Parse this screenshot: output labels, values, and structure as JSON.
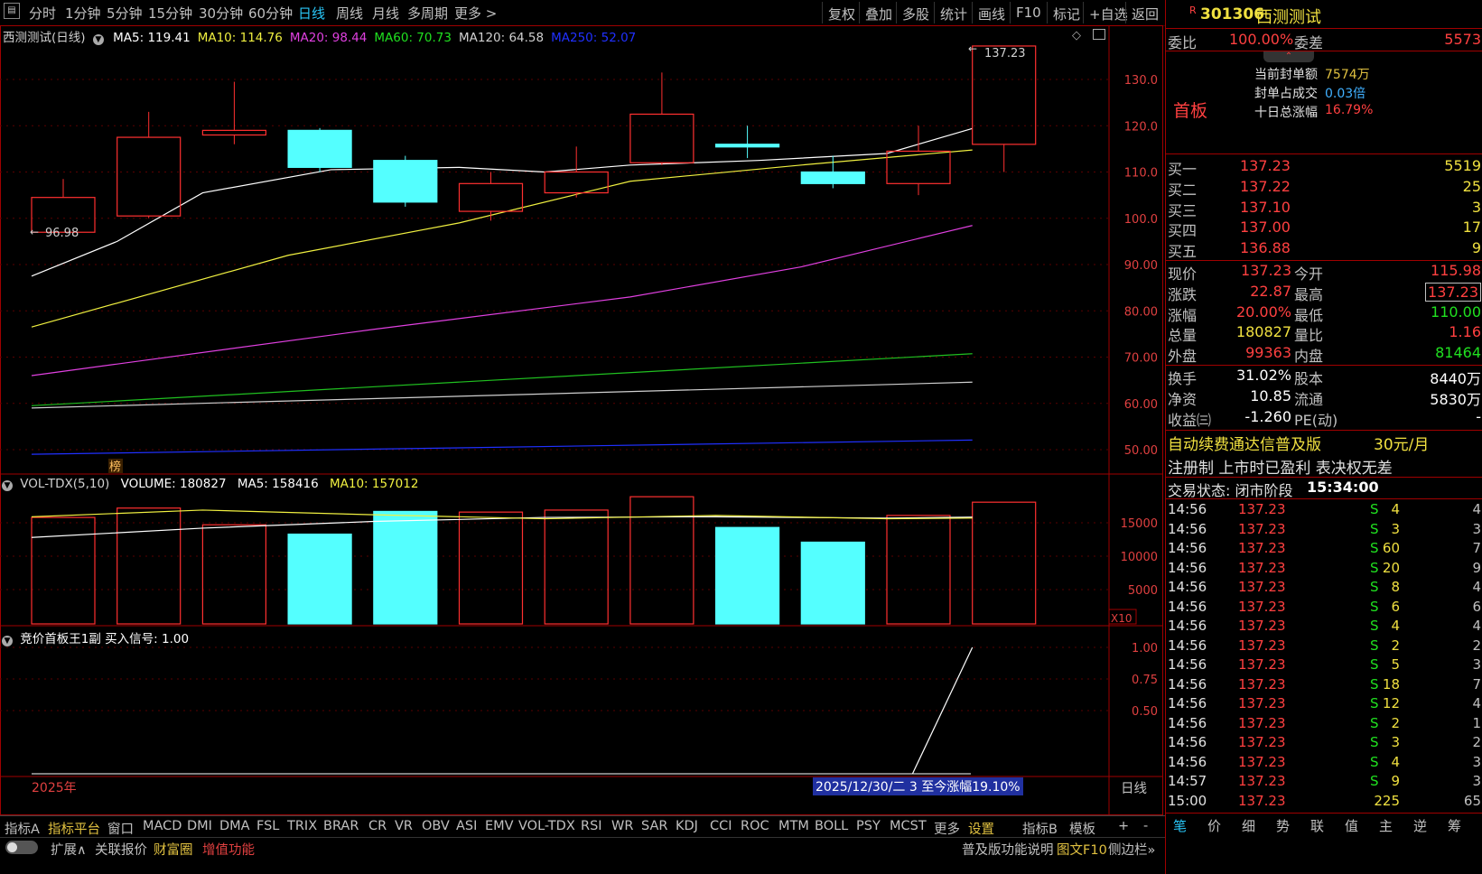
{
  "toolbar": {
    "left_items": [
      "分时",
      "1分钟",
      "5分钟",
      "15分钟",
      "30分钟",
      "60分钟",
      "日线",
      "周线",
      "月线",
      "多周期",
      "更多 >"
    ],
    "active": "日线",
    "right_items": [
      "复权",
      "叠加",
      "多股",
      "统计",
      "画线",
      "F10",
      "标记",
      "+自选",
      "返回"
    ]
  },
  "main": {
    "title": "西测测试(日线)",
    "ma": [
      {
        "label": "MA5: 119.41",
        "color": "#ffffff"
      },
      {
        "label": "MA10: 114.76",
        "color": "#f0f040"
      },
      {
        "label": "MA20: 98.44",
        "color": "#e040e0"
      },
      {
        "label": "MA60: 70.73",
        "color": "#20e020"
      },
      {
        "label": "MA120: 64.58",
        "color": "#d0d0d0"
      },
      {
        "label": "MA250: 52.07",
        "color": "#2030ff"
      }
    ],
    "high_label": "137.23",
    "low_label": "96.98",
    "bang_label": "榜",
    "y_ticks": [
      "130.0",
      "120.0",
      "110.0",
      "100.0",
      "90.00",
      "80.00",
      "70.00",
      "60.00",
      "50.00"
    ]
  },
  "volume": {
    "legend": [
      "VOL-TDX(5,10)",
      "VOLUME: 180827",
      "MA5: 158416",
      "MA10: 157012"
    ],
    "y_ticks": [
      "15000",
      "10000",
      "5000"
    ],
    "unit": "X10"
  },
  "indicator": {
    "legend": "竞价首板王1副  买入信号: 1.00",
    "y_ticks": [
      "1.00",
      "0.75",
      "0.50"
    ]
  },
  "xaxis": {
    "year": "2025年",
    "info": "2025/12/30/二 3 至今涨幅19.10%",
    "period": "日线"
  },
  "tabs": [
    "指标A",
    "指标平台",
    "窗口",
    "MACD",
    "DMI",
    "DMA",
    "FSL",
    "TRIX",
    "BRAR",
    "CR",
    "VR",
    "OBV",
    "ASI",
    "EMV",
    "VOL-TDX",
    "RSI",
    "WR",
    "SAR",
    "KDJ",
    "CCI",
    "ROC",
    "MTM",
    "BOLL",
    "PSY",
    "MCST",
    "更多",
    "设置",
    "指标B",
    "模板",
    "+",
    "-"
  ],
  "status": {
    "expand": "扩展∧",
    "linked": "关联报价",
    "cfq": "财富圈",
    "zzgn": "增值功能",
    "help": "普及版功能说明",
    "f10": "图文F10",
    "side": "侧边栏»"
  },
  "quote": {
    "code": "301306",
    "name": "西测测试",
    "flag": "R",
    "weibi_label": "委比",
    "weibi": "100.00%",
    "weicha_label": "委差",
    "weicha": "5573",
    "board": "首板",
    "seal_lines": [
      {
        "label": "当前封单额",
        "value": "7574万"
      },
      {
        "label": "封单占成交",
        "value": "0.03倍"
      },
      {
        "label": "十日总涨幅",
        "value": "16.79%"
      }
    ],
    "bids": [
      {
        "label": "买一",
        "price": "137.23",
        "vol": "5519"
      },
      {
        "label": "买二",
        "price": "137.22",
        "vol": "25"
      },
      {
        "label": "买三",
        "price": "137.10",
        "vol": "3"
      },
      {
        "label": "买四",
        "price": "137.00",
        "vol": "17"
      },
      {
        "label": "买五",
        "price": "136.88",
        "vol": "9"
      }
    ],
    "stats": [
      {
        "l1": "现价",
        "v1": "137.23",
        "c1": "red",
        "l2": "今开",
        "v2": "115.98",
        "c2": "red"
      },
      {
        "l1": "涨跌",
        "v1": "22.87",
        "c1": "red",
        "l2": "最高",
        "v2": "137.23",
        "c2": "red"
      },
      {
        "l1": "涨幅",
        "v1": "20.00%",
        "c1": "red",
        "l2": "最低",
        "v2": "110.00",
        "c2": "green"
      },
      {
        "l1": "总量",
        "v1": "180827",
        "c1": "yellow",
        "l2": "量比",
        "v2": "1.16",
        "c2": "red"
      },
      {
        "l1": "外盘",
        "v1": "99363",
        "c1": "red",
        "l2": "内盘",
        "v2": "81464",
        "c2": "green"
      }
    ],
    "stats2": [
      {
        "l1": "换手",
        "v1": "31.02%",
        "l2": "股本",
        "v2": "8440万"
      },
      {
        "l1": "净资",
        "v1": "10.85",
        "l2": "流通",
        "v2": "5830万"
      },
      {
        "l1": "收益㈢",
        "v1": "-1.260",
        "l2": "PE(动)",
        "v2": "-"
      }
    ],
    "ad1": "自动续费通达信普及版",
    "ad1_price": "30元/月",
    "ad2": "注册制 上市时已盈利 表决权无差",
    "trade_state": "交易状态: 闭市阶段",
    "trade_time": "15:34:00",
    "ticks": [
      {
        "t": "14:56",
        "p": "137.23",
        "q": "4",
        "s": "S",
        "n": "4"
      },
      {
        "t": "14:56",
        "p": "137.23",
        "q": "3",
        "s": "S",
        "n": "3"
      },
      {
        "t": "14:56",
        "p": "137.23",
        "q": "60",
        "s": "S",
        "n": "7"
      },
      {
        "t": "14:56",
        "p": "137.23",
        "q": "20",
        "s": "S",
        "n": "9"
      },
      {
        "t": "14:56",
        "p": "137.23",
        "q": "8",
        "s": "S",
        "n": "4"
      },
      {
        "t": "14:56",
        "p": "137.23",
        "q": "6",
        "s": "S",
        "n": "6"
      },
      {
        "t": "14:56",
        "p": "137.23",
        "q": "4",
        "s": "S",
        "n": "4"
      },
      {
        "t": "14:56",
        "p": "137.23",
        "q": "2",
        "s": "S",
        "n": "2"
      },
      {
        "t": "14:56",
        "p": "137.23",
        "q": "5",
        "s": "S",
        "n": "3"
      },
      {
        "t": "14:56",
        "p": "137.23",
        "q": "18",
        "s": "S",
        "n": "7"
      },
      {
        "t": "14:56",
        "p": "137.23",
        "q": "12",
        "s": "S",
        "n": "4"
      },
      {
        "t": "14:56",
        "p": "137.23",
        "q": "2",
        "s": "S",
        "n": "1"
      },
      {
        "t": "14:56",
        "p": "137.23",
        "q": "3",
        "s": "S",
        "n": "2"
      },
      {
        "t": "14:56",
        "p": "137.23",
        "q": "4",
        "s": "S",
        "n": "3"
      },
      {
        "t": "14:57",
        "p": "137.23",
        "q": "9",
        "s": "S",
        "n": "3"
      },
      {
        "t": "15:00",
        "p": "137.23",
        "q": "225",
        "s": "",
        "n": "65"
      }
    ],
    "bottom_tabs": [
      "笔",
      "价",
      "细",
      "势",
      "联",
      "值",
      "主",
      "逆",
      "筹"
    ]
  },
  "chart_data": {
    "type": "candlestick",
    "candles": [
      {
        "o": 96.98,
        "c": 104.5,
        "h": 108.5,
        "l": 96.98,
        "up": true
      },
      {
        "o": 100.5,
        "c": 117.5,
        "h": 123.0,
        "l": 100.0,
        "up": true
      },
      {
        "o": 118.0,
        "c": 119.0,
        "h": 129.5,
        "l": 116.0,
        "up": true
      },
      {
        "o": 119.0,
        "c": 111.0,
        "h": 119.5,
        "l": 110.0,
        "up": false
      },
      {
        "o": 112.5,
        "c": 103.5,
        "h": 113.5,
        "l": 102.5,
        "up": false
      },
      {
        "o": 101.5,
        "c": 107.5,
        "h": 110.0,
        "l": 99.5,
        "up": true
      },
      {
        "o": 105.5,
        "c": 110.0,
        "h": 115.5,
        "l": 104.5,
        "up": true
      },
      {
        "o": 112.0,
        "c": 122.5,
        "h": 131.5,
        "l": 111.5,
        "up": true
      },
      {
        "o": 116.0,
        "c": 115.5,
        "h": 120.0,
        "l": 113.0,
        "up": false
      },
      {
        "o": 110.0,
        "c": 107.5,
        "h": 113.5,
        "l": 106.5,
        "up": false
      },
      {
        "o": 107.5,
        "c": 114.5,
        "h": 120.0,
        "l": 105.0,
        "up": true
      },
      {
        "o": 115.98,
        "c": 137.23,
        "h": 137.23,
        "l": 110.0,
        "up": true
      }
    ],
    "ma5": [
      [
        0,
        87.5
      ],
      [
        2,
        95
      ],
      [
        4,
        105.5
      ],
      [
        7,
        110.5
      ],
      [
        10,
        111
      ],
      [
        12,
        110
      ],
      [
        14,
        111.5
      ],
      [
        17,
        112.5
      ],
      [
        20,
        114
      ],
      [
        22,
        119.41
      ]
    ],
    "ma10": [
      [
        0,
        76.5
      ],
      [
        6,
        92
      ],
      [
        10,
        99
      ],
      [
        14,
        108
      ],
      [
        18,
        111.5
      ],
      [
        22,
        114.76
      ]
    ],
    "ma20": [
      [
        0,
        66
      ],
      [
        8,
        76
      ],
      [
        14,
        83
      ],
      [
        18,
        89.5
      ],
      [
        22,
        98.44
      ]
    ],
    "ma60": [
      [
        0,
        59.5
      ],
      [
        22,
        70.73
      ]
    ],
    "ma120": [
      [
        0,
        59
      ],
      [
        22,
        64.58
      ]
    ],
    "ma250": [
      [
        0,
        49
      ],
      [
        22,
        52.07
      ]
    ],
    "volumes": [
      {
        "v": 15800,
        "up": true
      },
      {
        "v": 17200,
        "up": true
      },
      {
        "v": 14700,
        "up": true
      },
      {
        "v": 13300,
        "up": false
      },
      {
        "v": 16700,
        "up": false
      },
      {
        "v": 16600,
        "up": true
      },
      {
        "v": 16900,
        "up": true
      },
      {
        "v": 18900,
        "up": true
      },
      {
        "v": 14300,
        "up": false
      },
      {
        "v": 12100,
        "up": false
      },
      {
        "v": 16100,
        "up": true
      },
      {
        "v": 18082.7,
        "up": true
      }
    ],
    "vol_ma5": [
      [
        0,
        12800
      ],
      [
        4,
        14200
      ],
      [
        8,
        15200
      ],
      [
        12,
        15800
      ],
      [
        16,
        15900
      ],
      [
        20,
        15700
      ],
      [
        22,
        15841.6
      ]
    ],
    "vol_ma10": [
      [
        0,
        15900
      ],
      [
        4,
        16900
      ],
      [
        8,
        16200
      ],
      [
        12,
        15600
      ],
      [
        16,
        16100
      ],
      [
        20,
        15600
      ],
      [
        22,
        15701.2
      ]
    ],
    "signal": [
      [
        20.6,
        0
      ],
      [
        22,
        1.0
      ]
    ]
  }
}
